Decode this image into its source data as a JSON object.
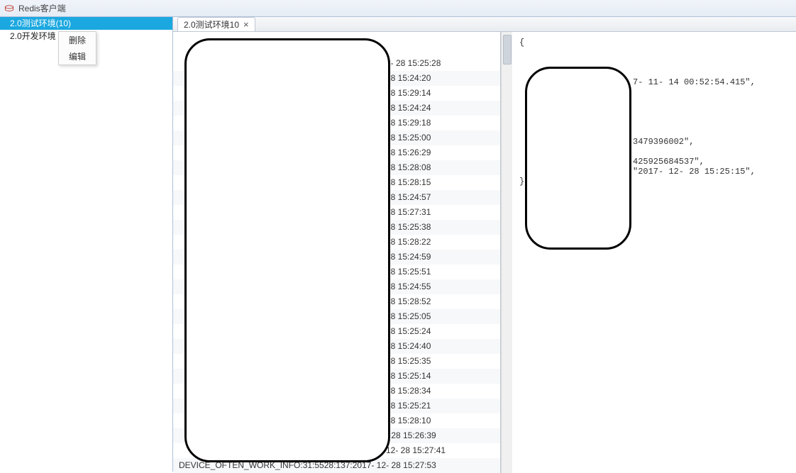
{
  "titlebar": {
    "title": "Redis客户端"
  },
  "sidebar": {
    "items": [
      {
        "label": "2.0测试环境(10)",
        "selected": true
      },
      {
        "label": "2.0开发环境",
        "selected": false
      }
    ]
  },
  "context_menu": {
    "items": [
      {
        "label": "删除"
      },
      {
        "label": "编辑"
      }
    ]
  },
  "tab": {
    "label": "2.0测试环境10",
    "close": "×"
  },
  "keys_prefix": "DEVICE_OFTEN_WORK_INFO:31:5528:137:2017-",
  "keys": [
    "2- 28 15:25:28",
    " 28 15:24:20",
    " 28 15:29:14",
    " 28 15:24:24",
    " 28 15:29:18",
    " 28 15:25:00",
    " 28 15:26:29",
    " 28 15:28:08",
    " 28 15:28:15",
    " 28 15:24:57",
    " 28 15:27:31",
    "28 15:25:38",
    "28 15:28:22",
    " 28 15:24:59",
    " 28 15:25:51",
    " 28 15:24:55",
    " 28 15:28:52",
    " 28 15:25:05",
    " 28 15:25:24",
    " 28 15:24:40",
    " 28 15:25:35",
    " 28 15:25:14",
    " 28 15:28:34",
    " 28 15:25:21",
    " 28 15:28:10",
    "- 28 15:26:39",
    "12- 28 15:27:41",
    "DEVICE_OFTEN_WORK_INFO:31:5528:137:2017- 12- 28 15:27:53"
  ],
  "detail": {
    "lines": [
      "{",
      "",
      "",
      "",
      "7- 11- 14 00:52:54.415\",",
      "",
      "",
      "",
      "",
      "",
      "3479396002\",",
      "",
      "425925684537\",",
      "\"2017- 12- 28 15:25:15\",",
      "}"
    ]
  }
}
